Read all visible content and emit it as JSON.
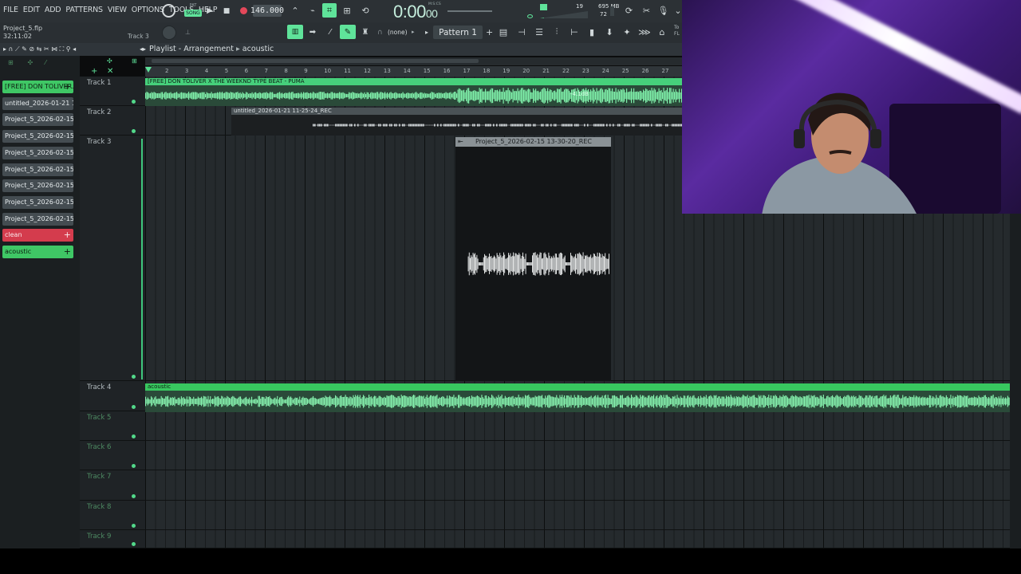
{
  "menu": [
    "FILE",
    "EDIT",
    "ADD",
    "PATTERNS",
    "VIEW",
    "OPTIONS",
    "TOOLS",
    "HELP"
  ],
  "transport": {
    "mode_small": "PAT",
    "mode": "SONG",
    "tempo": "146.000",
    "time": "0:00",
    "time_sub": "00",
    "time_label": "M:S:CS"
  },
  "stats": {
    "cpu": "19",
    "memory": "695 MB",
    "polyphony": "72"
  },
  "project": {
    "name": "Project_5.flp",
    "elapsed": "32:11:02",
    "focus_track": "Track 3"
  },
  "toolbar2": {
    "channel": "(none)",
    "pattern": "Pattern 1",
    "right_text": "To FL"
  },
  "playlist": {
    "title": "Playlist - Arrangement",
    "breadcrumb": "acoustic"
  },
  "picker": [
    {
      "label": "[FREE] DON TOLIVER...",
      "style": "green",
      "plus": "+"
    },
    {
      "label": "untitled_2026-01-21 11-...",
      "style": "normal"
    },
    {
      "label": "Project_5_2026-02-15 1...",
      "style": "normal"
    },
    {
      "label": "Project_5_2026-02-15 1...",
      "style": "normal"
    },
    {
      "label": "Project_5_2026-02-15 1...",
      "style": "normal"
    },
    {
      "label": "Project_5_2026-02-15 1...",
      "style": "normal"
    },
    {
      "label": "Project_5_2026-02-15 1...",
      "style": "normal"
    },
    {
      "label": "Project_5_2026-02-15 1...",
      "style": "normal"
    },
    {
      "label": "Project_5_2026-02-15 1...",
      "style": "normal"
    },
    {
      "label": "clean",
      "style": "red",
      "plus": "+"
    },
    {
      "label": "acoustic",
      "style": "green",
      "plus": "+"
    }
  ],
  "ruler": [
    "2",
    "3",
    "4",
    "5",
    "6",
    "7",
    "8",
    "9",
    "10",
    "11",
    "12",
    "13",
    "14",
    "15",
    "16",
    "17",
    "18",
    "19",
    "20",
    "21",
    "22",
    "23",
    "24",
    "25",
    "26",
    "27"
  ],
  "tracks": [
    "Track 1",
    "Track 2",
    "Track 3",
    "Track 4",
    "Track 5",
    "Track 6",
    "Track 7",
    "Track 8",
    "Track 9"
  ],
  "clips": {
    "c1": "[FREE] DON TOLIVER X THE WEEKND TYPE BEAT - PUMA",
    "c1_gain": "-4.1dB",
    "c2": "untitled_2026-01-21 11-25-24_REC",
    "c3": "Project_5_2026-02-15 13-30-20_REC",
    "c4": "acoustic"
  },
  "colors": {
    "accent": "#5fe39a",
    "clip_green": "#46d07b",
    "clip_red": "#d43c4d",
    "background": "#252a2d"
  },
  "icons": [
    "record-icon",
    "play-icon",
    "stop-icon",
    "metronome-icon",
    "pencil-icon",
    "paint-icon",
    "mic-icon",
    "snap-icon",
    "magnet-icon",
    "zoom-icon",
    "speaker-icon"
  ]
}
